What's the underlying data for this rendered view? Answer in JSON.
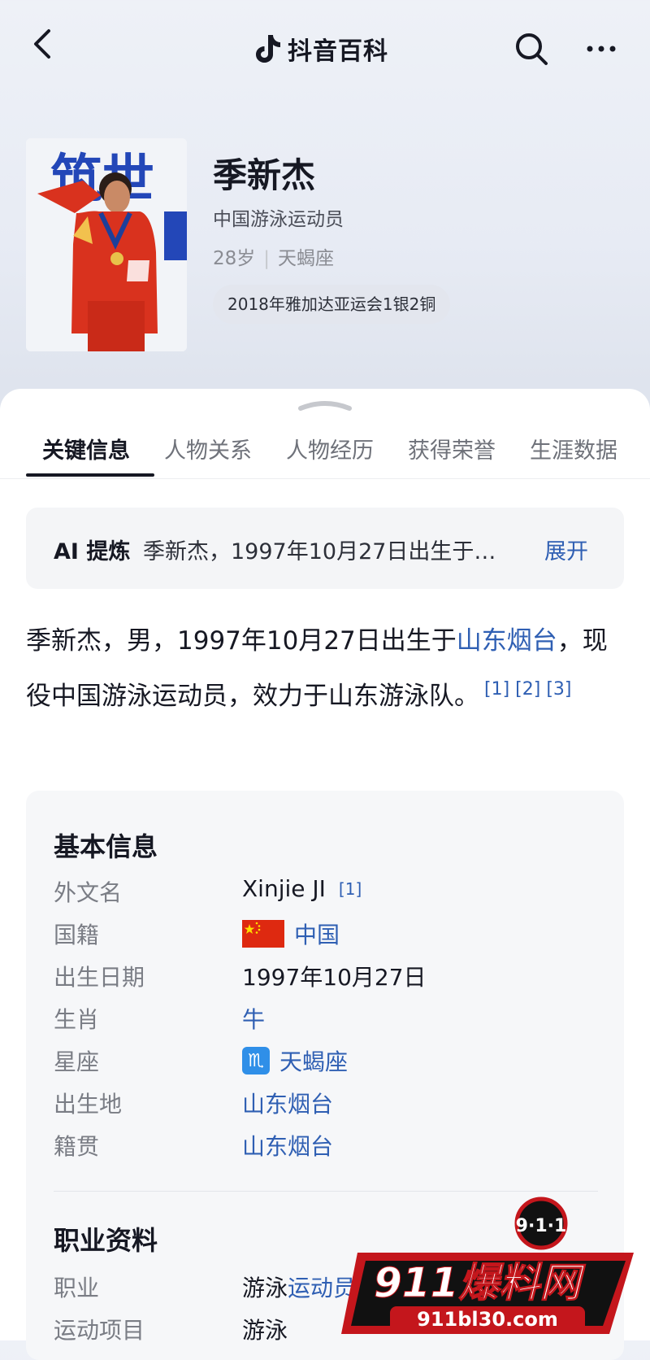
{
  "header": {
    "brand_name": "抖音百科",
    "icons": [
      "back-arrow-icon",
      "douyin-logo-icon",
      "search-icon",
      "more-icon"
    ]
  },
  "profile": {
    "name": "季新杰",
    "subtitle": "中国游泳运动员",
    "age": "28岁",
    "zodiac": "天蝎座",
    "badge": "2018年雅加达亚运会1银2铜",
    "photo_text": "筑世"
  },
  "tabs": [
    "关键信息",
    "人物关系",
    "人物经历",
    "获得荣誉",
    "生涯数据"
  ],
  "ai_summary": {
    "label": "AI 提炼",
    "text": "季新杰，1997年10月27日出生于…",
    "expand": "展开"
  },
  "intro": {
    "text_1": "季新杰，男，1997年10月27日出生于",
    "link_1": "山东烟台",
    "text_2": "，现役中国游泳运动员，效力于山东游泳队。",
    "refs": "[1] [2] [3]"
  },
  "basic_info": {
    "title": "基本信息",
    "foreign_name": {
      "label": "外文名",
      "value": "Xinjie JI",
      "ref": "[1]"
    },
    "nationality": {
      "label": "国籍",
      "value": "中国"
    },
    "birth_date": {
      "label": "出生日期",
      "value": "1997年10月27日"
    },
    "chinese_zodiac": {
      "label": "生肖",
      "value": "牛"
    },
    "star_sign": {
      "label": "星座",
      "value": "天蝎座",
      "symbol": "♏"
    },
    "birthplace": {
      "label": "出生地",
      "value": "山东烟台"
    },
    "native_place": {
      "label": "籍贯",
      "value": "山东烟台"
    }
  },
  "career_info": {
    "title": "职业资料",
    "occupation": {
      "label": "职业",
      "value_plain": "游泳",
      "value_link": "运动员"
    },
    "sport": {
      "label": "运动项目",
      "value": "游泳"
    }
  },
  "watermark": {
    "badge": "9·1·1",
    "title": "911爆料网",
    "url": "911bl30.com"
  },
  "colors": {
    "link": "#2f5fb3",
    "text": "#161823",
    "muted": "#7a7d85",
    "flag_red": "#de2910",
    "flag_star": "#ffde00"
  }
}
